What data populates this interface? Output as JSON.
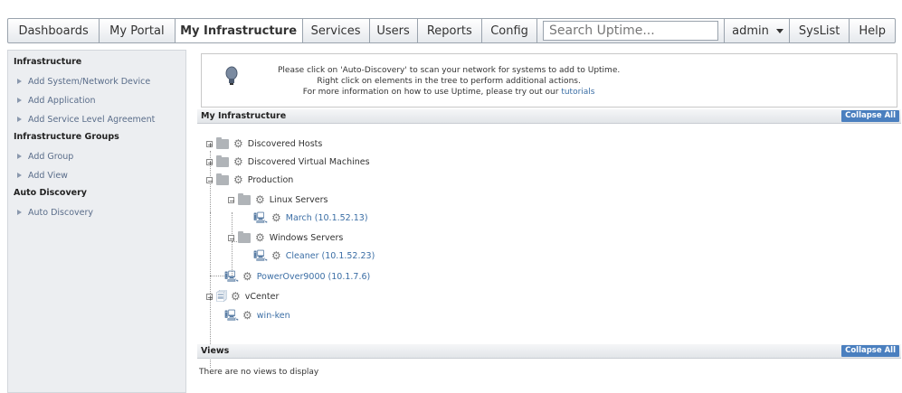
{
  "nav": {
    "tabs": [
      "Dashboards",
      "My Portal",
      "My Infrastructure",
      "Services",
      "Users",
      "Reports",
      "Config"
    ],
    "active_tab": "My Infrastructure",
    "search_placeholder": "Search Uptime...",
    "user": "admin",
    "syslist": "SysList",
    "help": "Help"
  },
  "sidebar": {
    "sections": [
      {
        "heading": "Infrastructure",
        "items": [
          "Add System/Network Device",
          "Add Application",
          "Add Service Level Agreement"
        ]
      },
      {
        "heading": "Infrastructure Groups",
        "items": [
          "Add Group",
          "Add View"
        ]
      },
      {
        "heading": "Auto Discovery",
        "items": [
          "Auto Discovery"
        ]
      }
    ]
  },
  "info": {
    "line1": "Please click on 'Auto-Discovery' to scan your network for systems to add to Uptime.",
    "line2": "Right click on elements in the tree to perform additional actions.",
    "line3_prefix": "For more information on how to use Uptime, please try out our ",
    "line3_link": "tutorials"
  },
  "infrastructure": {
    "title": "My Infrastructure",
    "collapse_label": "Collapse All",
    "tree": {
      "discovered_hosts": "Discovered Hosts",
      "discovered_vms": "Discovered Virtual Machines",
      "production": "Production",
      "linux_servers": "Linux Servers",
      "march": "March (10.1.52.13)",
      "windows_servers": "Windows Servers",
      "cleaner": "Cleaner (10.1.52.23)",
      "powerover": "PowerOver9000 (10.1.7.6)",
      "vcenter": "vCenter",
      "winken": "win-ken"
    }
  },
  "views": {
    "title": "Views",
    "collapse_label": "Collapse All",
    "empty_text": "There are no views to display"
  },
  "icons": {
    "expand": "plus-box-icon",
    "collapse": "minus-box-icon",
    "folder": "folder-icon",
    "gear": "gear-icon",
    "bulb": "lightbulb-icon"
  },
  "colors": {
    "link": "#3b6ea5",
    "collapse_button": "#4a7fbf",
    "sidebar_bg": "#eceef1"
  }
}
